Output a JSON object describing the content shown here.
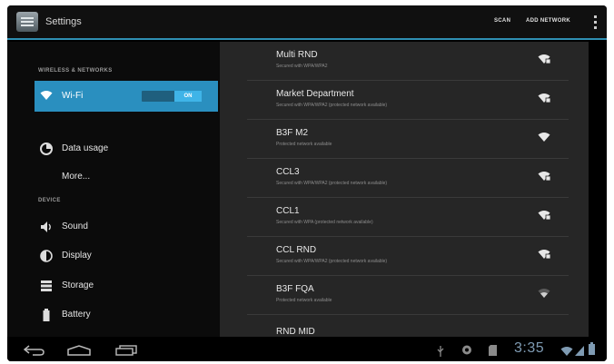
{
  "header": {
    "title": "Settings",
    "scan_label": "SCAN",
    "add_network_label": "ADD NETWORK"
  },
  "sidebar": {
    "section_wireless": "WIRELESS & NETWORKS",
    "wifi": {
      "label": "Wi-Fi",
      "toggle_state": "ON"
    },
    "data_usage": "Data usage",
    "more": "More...",
    "section_device": "DEVICE",
    "sound": "Sound",
    "display": "Display",
    "storage": "Storage",
    "battery": "Battery"
  },
  "networks": [
    {
      "name": "Multi RND",
      "status": "Secured with WPA/WPA2",
      "icon": "wifi-locked-icon"
    },
    {
      "name": "Market Department",
      "status": "Secured with WPA/WPA2 (protected network available)",
      "icon": "wifi-locked-icon"
    },
    {
      "name": "B3F M2",
      "status": "Protected network available",
      "icon": "wifi-open-icon"
    },
    {
      "name": "CCL3",
      "status": "Secured with WPA/WPA2 (protected network available)",
      "icon": "wifi-locked-icon"
    },
    {
      "name": "CCL1",
      "status": "Secured with WPA (protected network available)",
      "icon": "wifi-locked-icon"
    },
    {
      "name": "CCL RND",
      "status": "Secured with WPA/WPA2 (protected network available)",
      "icon": "wifi-locked-icon"
    },
    {
      "name": "B3F FQA",
      "status": "Protected network available",
      "icon": "wifi-weak-icon"
    },
    {
      "name": "RND MID",
      "status": "",
      "icon": ""
    }
  ],
  "statusbar": {
    "clock": "3:35"
  },
  "colors": {
    "accent": "#2a8fbf",
    "clock": "#7f9bb3"
  }
}
